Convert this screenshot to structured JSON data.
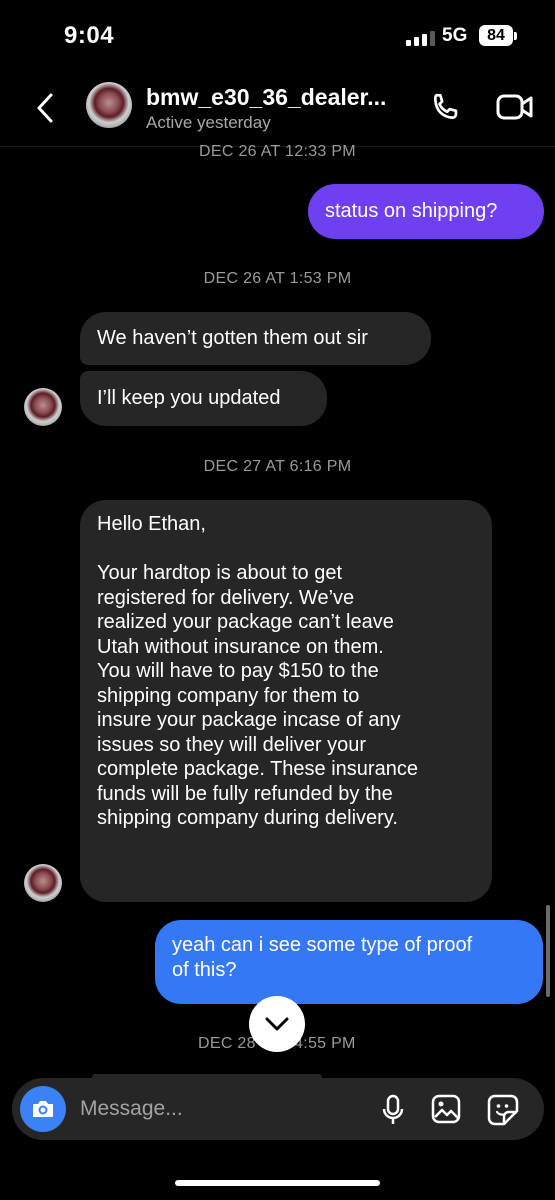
{
  "status_bar": {
    "time": "9:04",
    "network": "5G",
    "battery": "84"
  },
  "header": {
    "username": "bmw_e30_36_dealer...",
    "status": "Active yesterday",
    "icons": {
      "back": "back-arrow-icon",
      "call": "phone-icon",
      "video": "video-camera-icon"
    }
  },
  "messages": {
    "ts0": "DEC 26 AT 12:33 PM",
    "m1": "status on shipping?",
    "ts1": "DEC 26 AT 1:53 PM",
    "m2": "We haven’t gotten them out sir",
    "m3": "I’ll keep you updated",
    "ts2": "DEC 27 AT 6:16 PM",
    "m4_lines": [
      "Hello Ethan,",
      "",
      "Your hardtop is about to get",
      "registered for delivery. We’ve",
      "realized your package can’t leave",
      "Utah without insurance on them.",
      "You will have to pay $150 to the",
      "shipping company for them to",
      "insure your package incase of any",
      "issues so they will deliver your",
      "complete package. These insurance",
      "funds will be fully refunded by the",
      "shipping company during delivery."
    ],
    "m5_lines": [
      "yeah can i see some type of proof",
      "of this?"
    ],
    "ts3_left": "DEC 28",
    "ts3_right": "4:55 PM"
  },
  "composer": {
    "placeholder": "Message..."
  },
  "colors": {
    "outgoing_purple": "#6f3ff2",
    "outgoing_blue": "#3478f6",
    "incoming": "#262626",
    "accent": "#3b82f6"
  }
}
